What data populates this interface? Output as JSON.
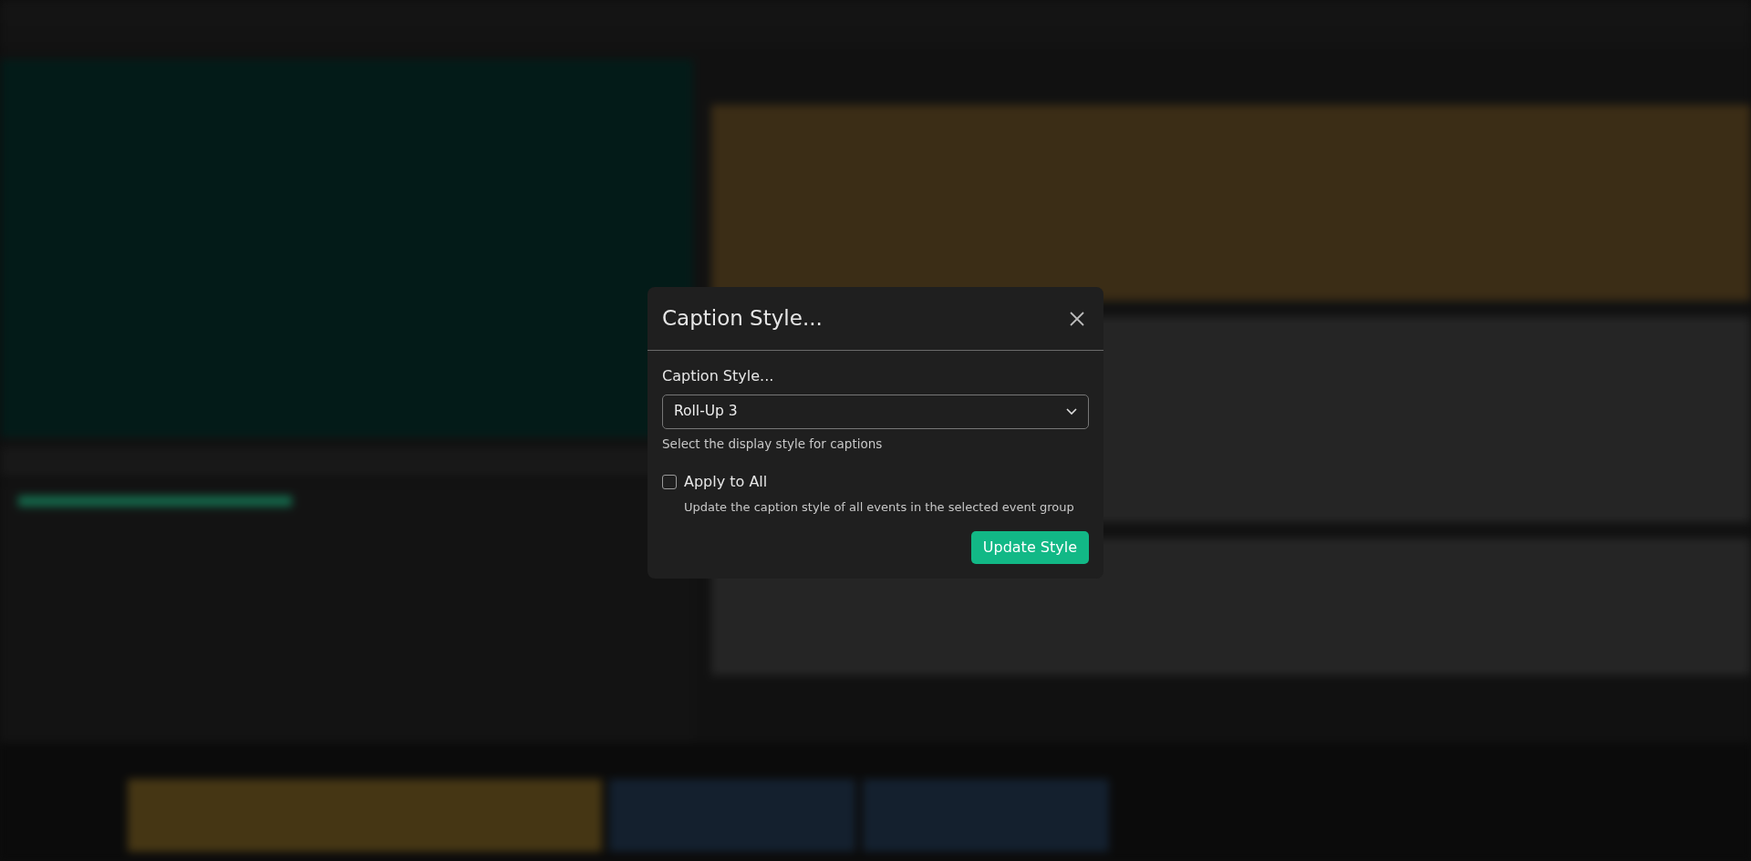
{
  "dialog": {
    "title": "Caption Style...",
    "field": {
      "label": "Caption Style...",
      "value": "Roll-Up 3",
      "help": "Select the display style for captions"
    },
    "apply_all": {
      "label": "Apply to All",
      "checked": false,
      "description": "Update the caption style of all events in the selected event group"
    },
    "button": "Update Style"
  }
}
